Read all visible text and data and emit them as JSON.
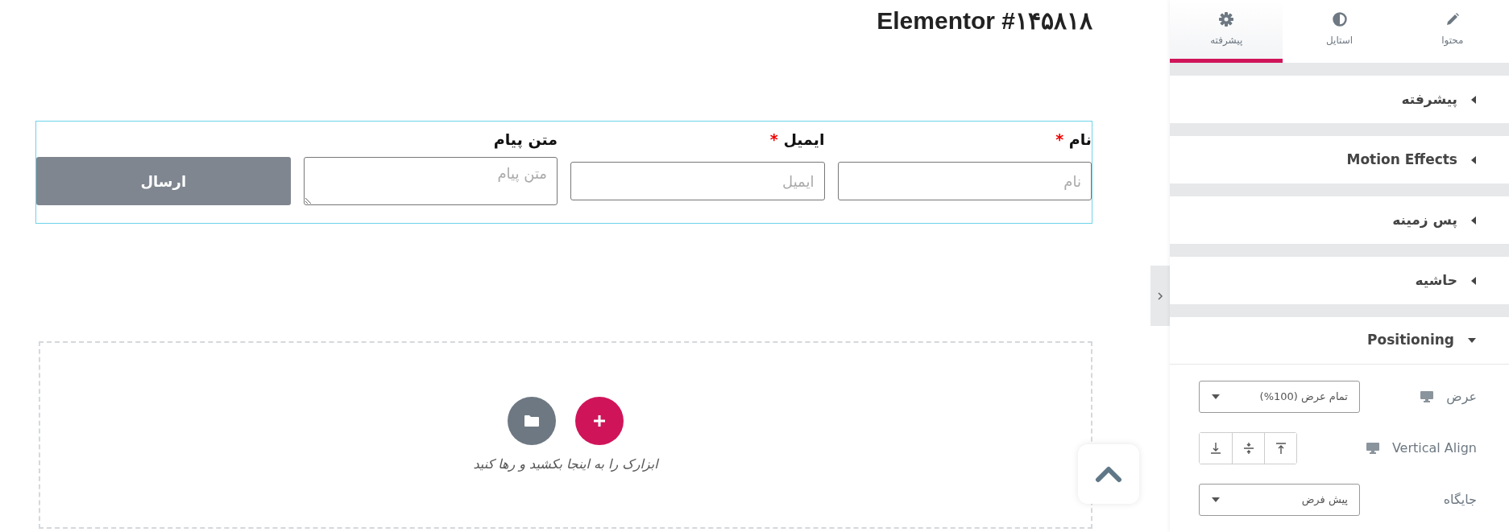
{
  "page_title": "Elementor #۱۴۵۸۱۸",
  "form": {
    "fields": [
      {
        "label": "نام",
        "required": true,
        "placeholder": "نام",
        "kind": "input"
      },
      {
        "label": "ایمیل",
        "required": true,
        "placeholder": "ایمیل",
        "kind": "input"
      },
      {
        "label": "متن پیام",
        "required": false,
        "placeholder": "متن پیام",
        "kind": "textarea"
      }
    ],
    "submit": "ارسال",
    "required_mark": "*"
  },
  "dropzone": {
    "hint": "ابزارک را به اینجا بکشید و رها کنید"
  },
  "sidebar": {
    "tabs": [
      {
        "label": "محتوا",
        "selected": false
      },
      {
        "label": "استایل",
        "selected": false
      },
      {
        "label": "پیشرفته",
        "selected": true
      }
    ],
    "sections": [
      {
        "title": "پیشرفته",
        "expanded": false
      },
      {
        "title": "Motion Effects",
        "expanded": false
      },
      {
        "title": "پس زمینه",
        "expanded": false
      },
      {
        "title": "حاشیه",
        "expanded": false
      },
      {
        "title": "Positioning",
        "expanded": true
      }
    ],
    "controls": [
      {
        "kind": "select",
        "label": "عرض",
        "responsive": true,
        "value": "تمام عرض (100%)"
      },
      {
        "kind": "buttons",
        "label": "Vertical Align",
        "responsive": true
      },
      {
        "kind": "select",
        "label": "جایگاه",
        "responsive": false,
        "value": "پیش فرض"
      }
    ]
  }
}
